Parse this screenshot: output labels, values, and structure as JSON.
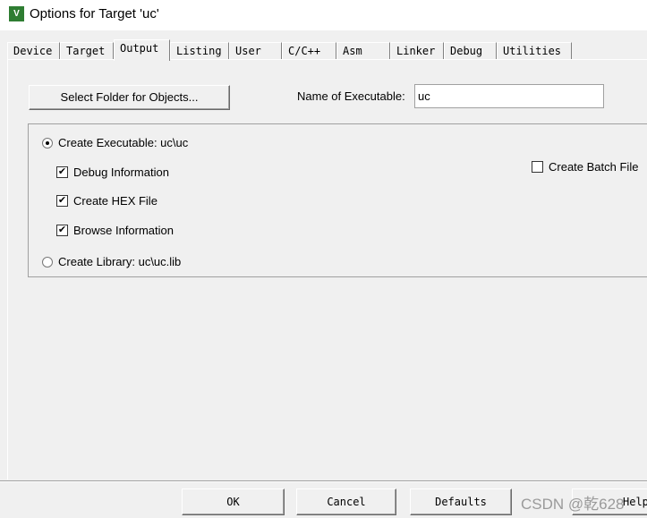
{
  "window": {
    "title": "Options for Target 'uc'",
    "icon": "keil-uvision-icon"
  },
  "tabs": [
    "Device",
    "Target",
    "Output",
    "Listing",
    "User",
    "C/C++",
    "Asm",
    "Linker",
    "Debug",
    "Utilities"
  ],
  "active_tab": "Output",
  "output": {
    "select_folder_label": "Select Folder for Objects...",
    "name_of_executable_label": "Name of Executable:",
    "name_of_executable_value": "uc",
    "create_executable_label": "Create Executable:  uc\\uc",
    "create_executable_selected": true,
    "debug_information_label": "Debug Information",
    "debug_information_checked": true,
    "create_hex_label": "Create HEX File",
    "create_hex_checked": true,
    "browse_information_label": "Browse Information",
    "browse_information_checked": true,
    "create_library_label": "Create Library:  uc\\uc.lib",
    "create_library_selected": false,
    "create_batch_label": "Create Batch File",
    "create_batch_checked": false
  },
  "buttons": {
    "ok": "OK",
    "cancel": "Cancel",
    "defaults": "Defaults",
    "help": "Help"
  },
  "watermark": "CSDN @乾628"
}
